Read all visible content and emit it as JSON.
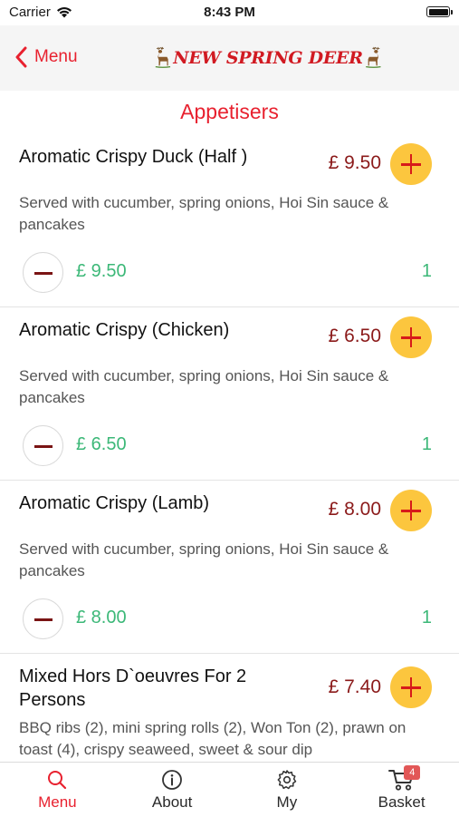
{
  "status_bar": {
    "carrier": "Carrier",
    "time": "8:43 PM"
  },
  "nav": {
    "back_label": "Menu",
    "logo_text": "NEW SPRING DEER"
  },
  "section_title": "Appetisers",
  "items": [
    {
      "name": "Aromatic Crispy Duck (Half )",
      "price": "£ 9.50",
      "description": "Served with cucumber, spring onions, Hoi Sin sauce & pancakes",
      "line_total": "£ 9.50",
      "quantity": "1"
    },
    {
      "name": "Aromatic Crispy (Chicken)",
      "price": "£ 6.50",
      "description": "Served with cucumber, spring onions, Hoi Sin sauce & pancakes",
      "line_total": "£ 6.50",
      "quantity": "1"
    },
    {
      "name": "Aromatic Crispy (Lamb)",
      "price": "£ 8.00",
      "description": "Served with cucumber, spring onions, Hoi Sin sauce & pancakes",
      "line_total": "£ 8.00",
      "quantity": "1"
    },
    {
      "name": "Mixed Hors D`oeuvres For 2 Persons",
      "price": "£ 7.40",
      "description": "BBQ ribs (2), mini spring rolls (2), Won Ton (2), prawn on toast (4), crispy seaweed, sweet & sour dip"
    }
  ],
  "tabs": [
    {
      "label": "Menu",
      "icon": "search-icon",
      "active": true
    },
    {
      "label": "About",
      "icon": "info-icon"
    },
    {
      "label": "My",
      "icon": "gear-icon"
    },
    {
      "label": "Basket",
      "icon": "cart-icon",
      "badge": "4"
    }
  ],
  "colors": {
    "accent": "#e8212f",
    "price": "#8b1a1a",
    "add_button": "#fcc63e",
    "quantity": "#3cb878"
  }
}
